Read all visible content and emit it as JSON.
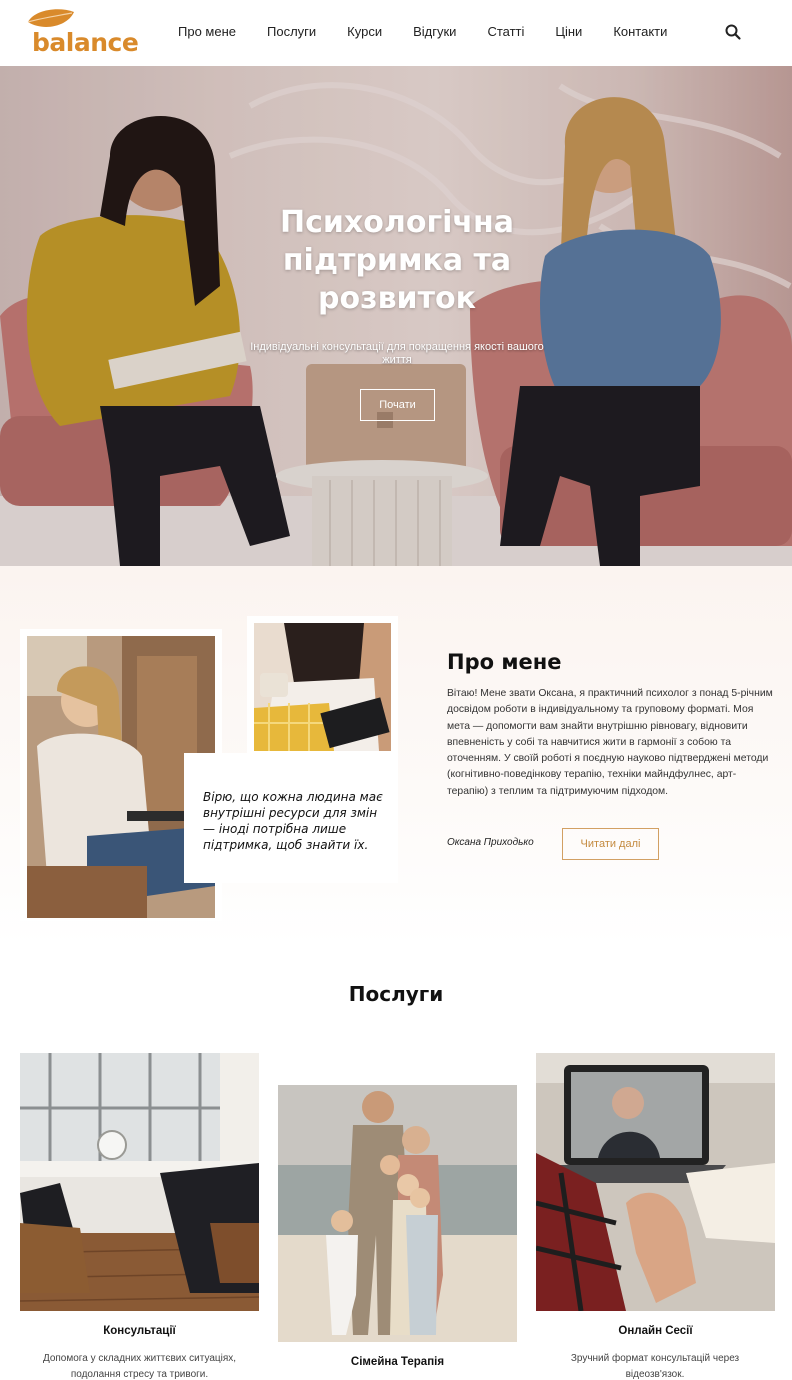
{
  "brand": {
    "name": "balance",
    "color": "#d98a2b"
  },
  "nav": {
    "items": [
      "Про мене",
      "Послуги",
      "Курси",
      "Відгуки",
      "Статті",
      "Ціни",
      "Контакти"
    ],
    "search_icon": "search-icon"
  },
  "hero": {
    "title": "Психологічна підтримка та розвиток",
    "subtitle": "Індивідуальні консультації для покращення якості вашого життя",
    "button_label": "Почати"
  },
  "about": {
    "quote": "Вірю, що кожна людина має внутрішні ресурси для змін — іноді потрібна лише підтримка, щоб знайти їх.",
    "title": "Про мене",
    "text": "Вітаю! Мене звати Оксана, я практичний психолог з понад 5-річним досвідом роботи в індивідуальному та груповому форматі. Моя мета — допомогти вам знайти внутрішню рівновагу, відновити впевненість у собі та навчитися жити в гармонії з собою та оточенням. У своїй роботі я поєдную науково підтверджені методи (когнітивно-поведінкову терапію, техніки майндфулнес, арт-терапію) з теплим та підтримуючим підходом.",
    "signature": "Оксана Приходько",
    "button_label": "Читати далі",
    "accent": "#c48a3e"
  },
  "services": {
    "title": "Послуги",
    "items": [
      {
        "name": "Консультації",
        "description": "Допомога у складних життєвих ситуаціях, подолання стресу та тривоги."
      },
      {
        "name": "Сімейна Терапія",
        "description": ""
      },
      {
        "name": "Онлайн Сесії",
        "description": "Зручний формат консультацій через відеозв'язок."
      }
    ]
  }
}
